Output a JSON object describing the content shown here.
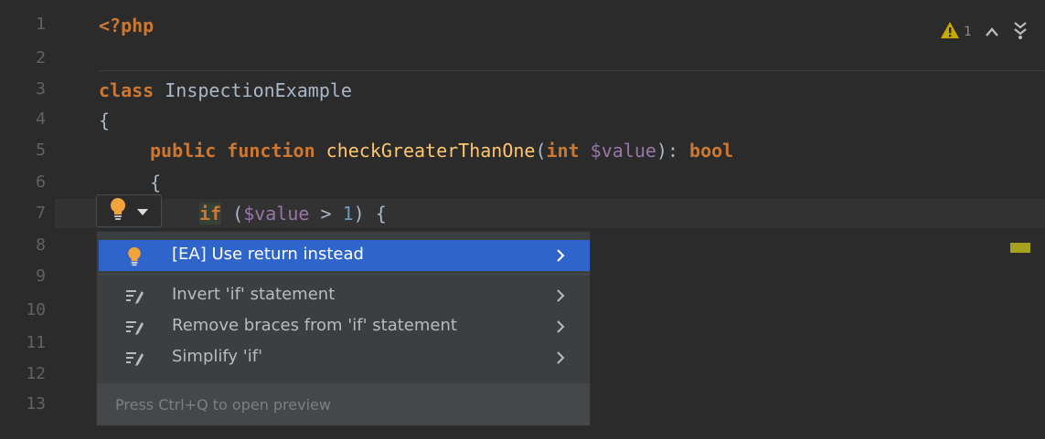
{
  "editor": {
    "line_numbers": [
      "1",
      "2",
      "3",
      "4",
      "5",
      "6",
      "7",
      "8",
      "9",
      "10",
      "11",
      "12",
      "13"
    ],
    "code": {
      "l1_tag": "<?php",
      "l3_kw": "class",
      "l3_name": " InspectionExample",
      "l4_brace": "{",
      "l5_public": "public",
      "l5_function": "function",
      "l5_fname": "checkGreaterThanOne",
      "l5_paren_open": "(",
      "l5_int": "int",
      "l5_var": "$value",
      "l5_tail": "): ",
      "l5_bool": "bool",
      "l6_brace": "{",
      "l7_if": "if",
      "l7_open": " (",
      "l7_var": "$value",
      "l7_op": " > ",
      "l7_num": "1",
      "l7_close": ") {"
    },
    "inspections": {
      "warning_count": "1"
    }
  },
  "popup": {
    "items": [
      {
        "label": "[EA] Use return instead",
        "icon": "lightbulb-icon",
        "selected": true
      },
      {
        "label": "Invert 'if' statement",
        "icon": "intention-icon",
        "selected": false
      },
      {
        "label": "Remove braces from 'if' statement",
        "icon": "intention-icon",
        "selected": false
      },
      {
        "label": "Simplify 'if'",
        "icon": "intention-icon",
        "selected": false
      }
    ],
    "footer": "Press Ctrl+Q to open preview"
  },
  "colors": {
    "background": "#2b2b2b",
    "keyword": "#cc7832",
    "function": "#ffc66d",
    "variable": "#9876aa",
    "number": "#6897bb",
    "selection": "#2f65ca",
    "warning": "#c7a900"
  }
}
